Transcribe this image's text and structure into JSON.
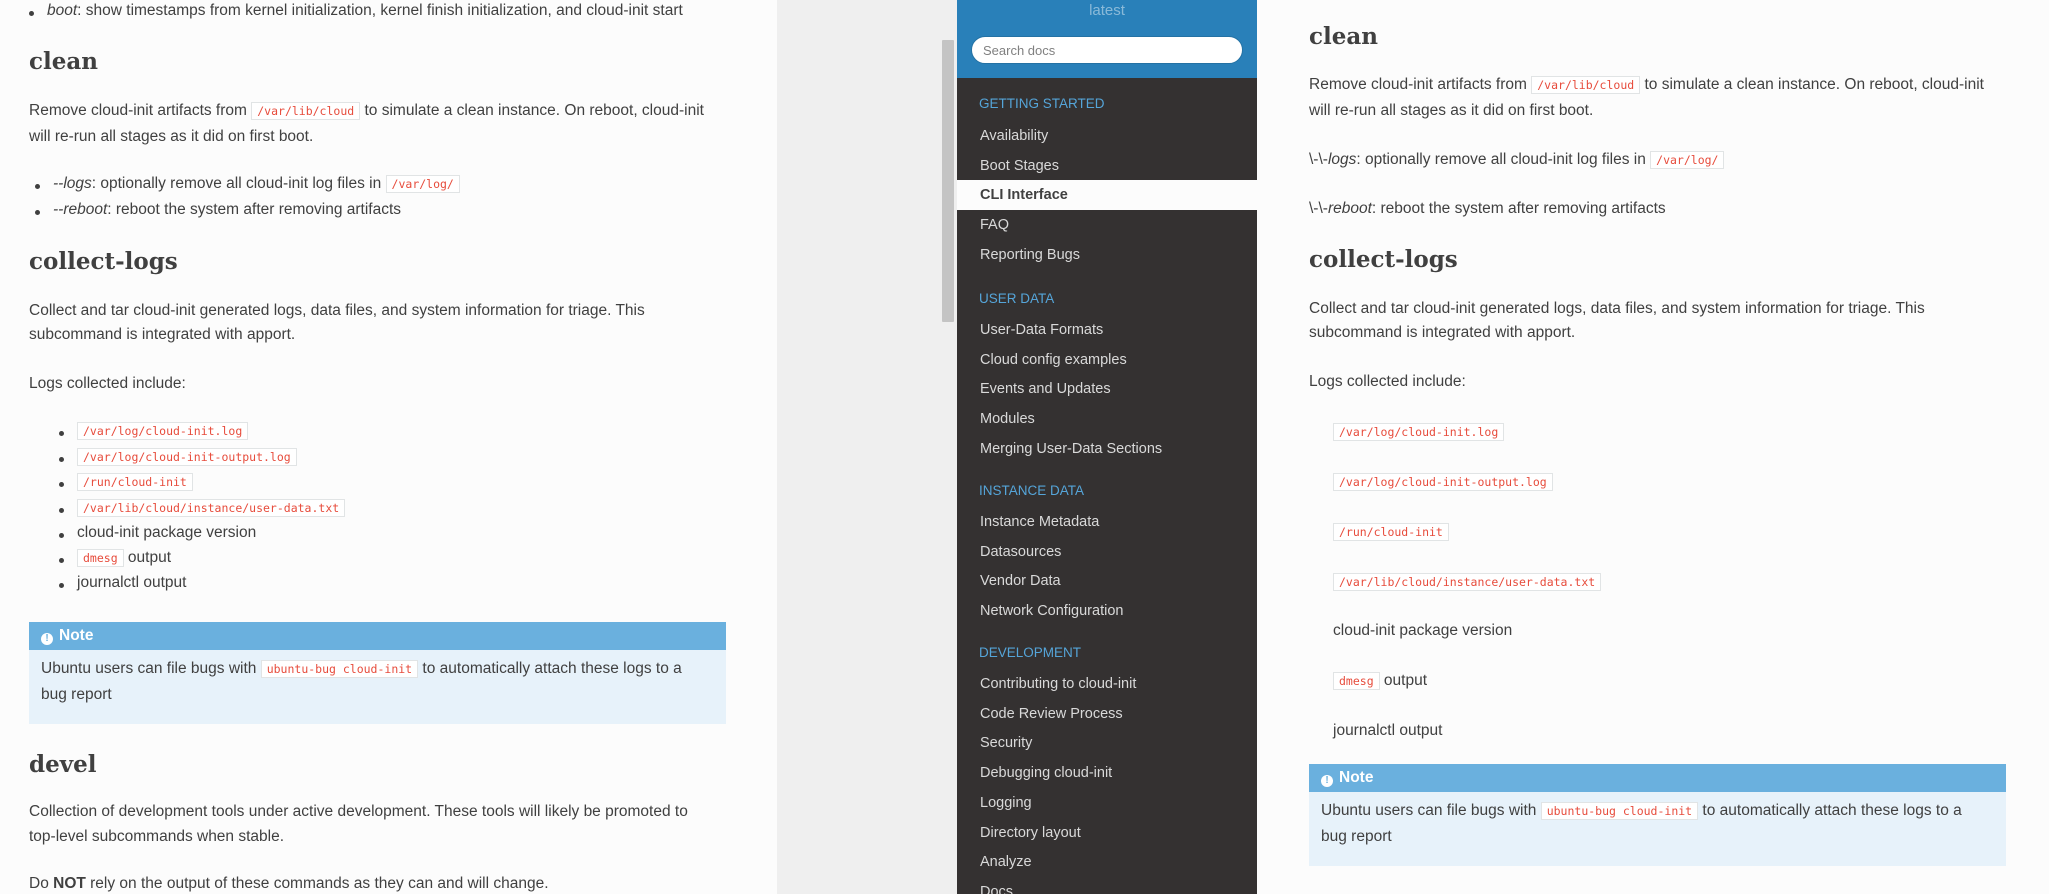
{
  "left": {
    "top_bullet": {
      "term": "boot",
      "text": ": show timestamps from kernel initialization, kernel finish initialization, and cloud-init start"
    },
    "clean": {
      "heading": "clean",
      "p1_a": "Remove cloud-init artifacts from ",
      "p1_code": "/var/lib/cloud",
      "p1_b": " to simulate a clean instance. On reboot, cloud-init",
      "p1_c": "will re-run all stages as it did on first boot.",
      "logs_term": "--logs",
      "logs_text": ": optionally remove all cloud-init log files in ",
      "logs_code": "/var/log/",
      "reboot_term": "--reboot",
      "reboot_text": ": reboot the system after removing artifacts"
    },
    "collect": {
      "heading": "collect-logs",
      "p1_a": "Collect and tar cloud-init generated logs, data files, and system information for triage. This",
      "p1_b": "subcommand is integrated with apport.",
      "p2": "Logs collected include:",
      "items": [
        {
          "code": "/var/log/cloud-init.log",
          "text": ""
        },
        {
          "code": "/var/log/cloud-init-output.log",
          "text": ""
        },
        {
          "code": "/run/cloud-init",
          "text": ""
        },
        {
          "code": "/var/lib/cloud/instance/user-data.txt",
          "text": ""
        },
        {
          "code": "",
          "text": "cloud-init package version"
        },
        {
          "code": "dmesg",
          "text": " output"
        },
        {
          "code": "",
          "text": "journalctl output"
        }
      ]
    },
    "note": {
      "title": "Note",
      "a": "Ubuntu users can file bugs with ",
      "code": "ubuntu-bug cloud-init",
      "b": " to automatically attach these logs to a",
      "c": "bug report"
    },
    "devel": {
      "heading": "devel",
      "p1_a": "Collection of development tools under active development. These tools will likely be promoted to",
      "p1_b": "top-level subcommands when stable.",
      "p2_a": "Do ",
      "p2_b": "NOT",
      "p2_c": " rely on the output of these commands as they can and will change."
    }
  },
  "nav": {
    "version": "latest",
    "search_placeholder": "Search docs",
    "sections": [
      {
        "caption": "GETTING STARTED",
        "items": [
          "Availability",
          "Boot Stages",
          "CLI Interface",
          "FAQ",
          "Reporting Bugs"
        ]
      },
      {
        "caption": "USER DATA",
        "items": [
          "User-Data Formats",
          "Cloud config examples",
          "Events and Updates",
          "Modules",
          "Merging User-Data Sections"
        ]
      },
      {
        "caption": "INSTANCE DATA",
        "items": [
          "Instance Metadata",
          "Datasources",
          "Vendor Data",
          "Network Configuration"
        ]
      },
      {
        "caption": "DEVELOPMENT",
        "items": [
          "Contributing to cloud-init",
          "Code Review Process",
          "Security",
          "Debugging cloud-init",
          "Logging",
          "Directory layout",
          "Analyze",
          "Docs"
        ]
      }
    ],
    "current": "CLI Interface"
  },
  "right": {
    "clean": {
      "heading": "clean",
      "p1_a": "Remove cloud-init artifacts from ",
      "p1_code": "/var/lib/cloud",
      "p1_b": " to simulate a clean instance. On reboot, cloud-init",
      "p1_c": "will re-run all stages as it did on first boot.",
      "logs_prefix": "\\-\\-",
      "logs_term": "logs",
      "logs_text": ": optionally remove all cloud-init log files in ",
      "logs_code": "/var/log/",
      "reboot_prefix": "\\-\\-",
      "reboot_term": "reboot",
      "reboot_text": ": reboot the system after removing artifacts"
    },
    "collect": {
      "heading": "collect-logs",
      "p1_a": "Collect and tar cloud-init generated logs, data files, and system information for triage. This",
      "p1_b": "subcommand is integrated with apport.",
      "p2": "Logs collected include:",
      "items": [
        {
          "code": "/var/log/cloud-init.log",
          "text": ""
        },
        {
          "code": "/var/log/cloud-init-output.log",
          "text": ""
        },
        {
          "code": "/run/cloud-init",
          "text": ""
        },
        {
          "code": "/var/lib/cloud/instance/user-data.txt",
          "text": ""
        },
        {
          "code": "",
          "text": "cloud-init package version"
        },
        {
          "code": "dmesg",
          "text": " output"
        },
        {
          "code": "",
          "text": "journalctl output"
        }
      ]
    },
    "note": {
      "title": "Note",
      "a": "Ubuntu users can file bugs with ",
      "code": "ubuntu-bug cloud-init",
      "b": " to automatically attach these logs to a",
      "c": "bug report"
    }
  },
  "icons": {
    "note": "info-circle-icon"
  },
  "colors": {
    "nav_bg": "#343131",
    "nav_top": "#2980b9",
    "caption": "#55a5d9",
    "code": "#e74c3c",
    "note_head": "#6ab0de",
    "note_bg": "#e7f2fa"
  }
}
